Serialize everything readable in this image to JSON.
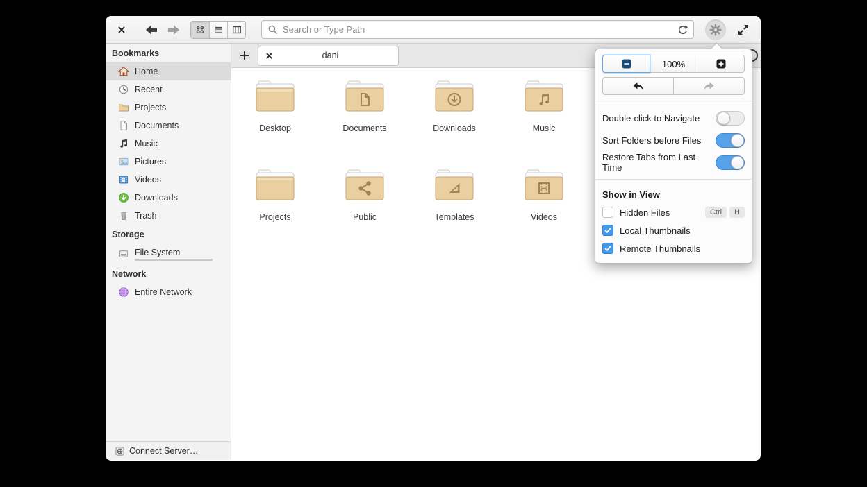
{
  "toolbar": {
    "search_placeholder": "Search or Type Path",
    "view_modes": [
      "grid",
      "list",
      "column"
    ],
    "active_view_mode": "grid"
  },
  "tabbar": {
    "tab_title": "dani"
  },
  "sidebar": {
    "sections": [
      {
        "header": "Bookmarks",
        "items": [
          {
            "label": "Home",
            "icon": "home-icon",
            "selected": true
          },
          {
            "label": "Recent",
            "icon": "recent-clock-icon",
            "selected": false
          },
          {
            "label": "Projects",
            "icon": "folder-icon",
            "selected": false
          },
          {
            "label": "Documents",
            "icon": "document-icon",
            "selected": false
          },
          {
            "label": "Music",
            "icon": "music-note-icon",
            "selected": false
          },
          {
            "label": "Pictures",
            "icon": "pictures-icon",
            "selected": false
          },
          {
            "label": "Videos",
            "icon": "film-icon",
            "selected": false
          },
          {
            "label": "Downloads",
            "icon": "download-circle-icon",
            "selected": false
          },
          {
            "label": "Trash",
            "icon": "trash-icon",
            "selected": false
          }
        ]
      },
      {
        "header": "Storage",
        "items": [
          {
            "label": "File System",
            "icon": "harddisk-icon",
            "usage_percent": 28
          }
        ]
      },
      {
        "header": "Network",
        "items": [
          {
            "label": "Entire Network",
            "icon": "network-globe-icon"
          }
        ]
      }
    ],
    "footer_label": "Connect Server…"
  },
  "files": {
    "items": [
      {
        "name": "Desktop",
        "emblem": "none"
      },
      {
        "name": "Documents",
        "emblem": "document"
      },
      {
        "name": "Downloads",
        "emblem": "download"
      },
      {
        "name": "Music",
        "emblem": "music"
      },
      {
        "name": "Projects",
        "emblem": "none"
      },
      {
        "name": "Public",
        "emblem": "share"
      },
      {
        "name": "Templates",
        "emblem": "template"
      },
      {
        "name": "Videos",
        "emblem": "film"
      }
    ]
  },
  "popover": {
    "zoom_level": "100%",
    "toggles": [
      {
        "label": "Double-click to Navigate",
        "on": false
      },
      {
        "label": "Sort Folders before Files",
        "on": true
      },
      {
        "label": "Restore Tabs from Last Time",
        "on": true
      }
    ],
    "show_in_view": {
      "header": "Show in View",
      "items": [
        {
          "label": "Hidden Files",
          "checked": false,
          "shortcut": [
            "Ctrl",
            "H"
          ]
        },
        {
          "label": "Local Thumbnails",
          "checked": true
        },
        {
          "label": "Remote Thumbnails",
          "checked": true
        }
      ]
    }
  },
  "icons": {
    "close": "x-cross",
    "back": "arrow-left",
    "forward": "arrow-right",
    "grid_view": "four-dots",
    "list_view": "horizontal-lines",
    "column_view": "columned-rect",
    "search": "magnifier",
    "refresh": "circular-arrow",
    "settings": "gear",
    "fullscreen": "diagonal-arrows",
    "new_tab": "plus",
    "tab_close": "x-cross",
    "zoom_out": "minus-square",
    "zoom_in": "plus-square",
    "undo": "curved-arrow-left",
    "redo": "curved-arrow-right"
  },
  "colors": {
    "accent": "#449ae8",
    "toggle_on": "#57a2e8",
    "folder": "#ead0a0",
    "selection": "#dcdcdc",
    "window_bg": "#ffffff",
    "chrome_bg": "#f4f4f4"
  }
}
